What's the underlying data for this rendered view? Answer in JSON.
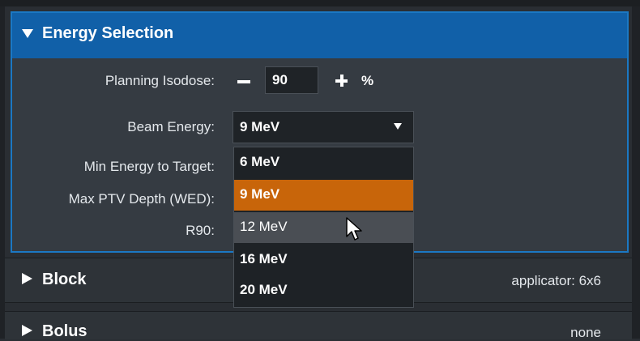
{
  "energy_selection": {
    "title": "Energy Selection",
    "header_icon": "triangle-down-icon",
    "planning_isodose_label": "Planning Isodose:",
    "planning_isodose_value": "90",
    "planning_isodose_unit": "%",
    "beam_energy_label": "Beam Energy:",
    "beam_energy_selected": "9 MeV",
    "min_energy_label": "Min Energy to Target:",
    "max_ptv_label": "Max PTV Depth (WED):",
    "r90_label": "R90:",
    "dropdown_options": [
      "6 MeV",
      "9 MeV",
      "12 MeV",
      "16 MeV",
      "20 MeV"
    ],
    "colors": {
      "header": "#1160a8",
      "selected_option": "#c8650a",
      "hover_option": "#4a4e54"
    }
  },
  "block": {
    "title": "Block",
    "header_icon": "triangle-right-icon",
    "value": "applicator: 6x6"
  },
  "bolus": {
    "title": "Bolus",
    "header_icon": "triangle-right-icon",
    "value": "none"
  }
}
